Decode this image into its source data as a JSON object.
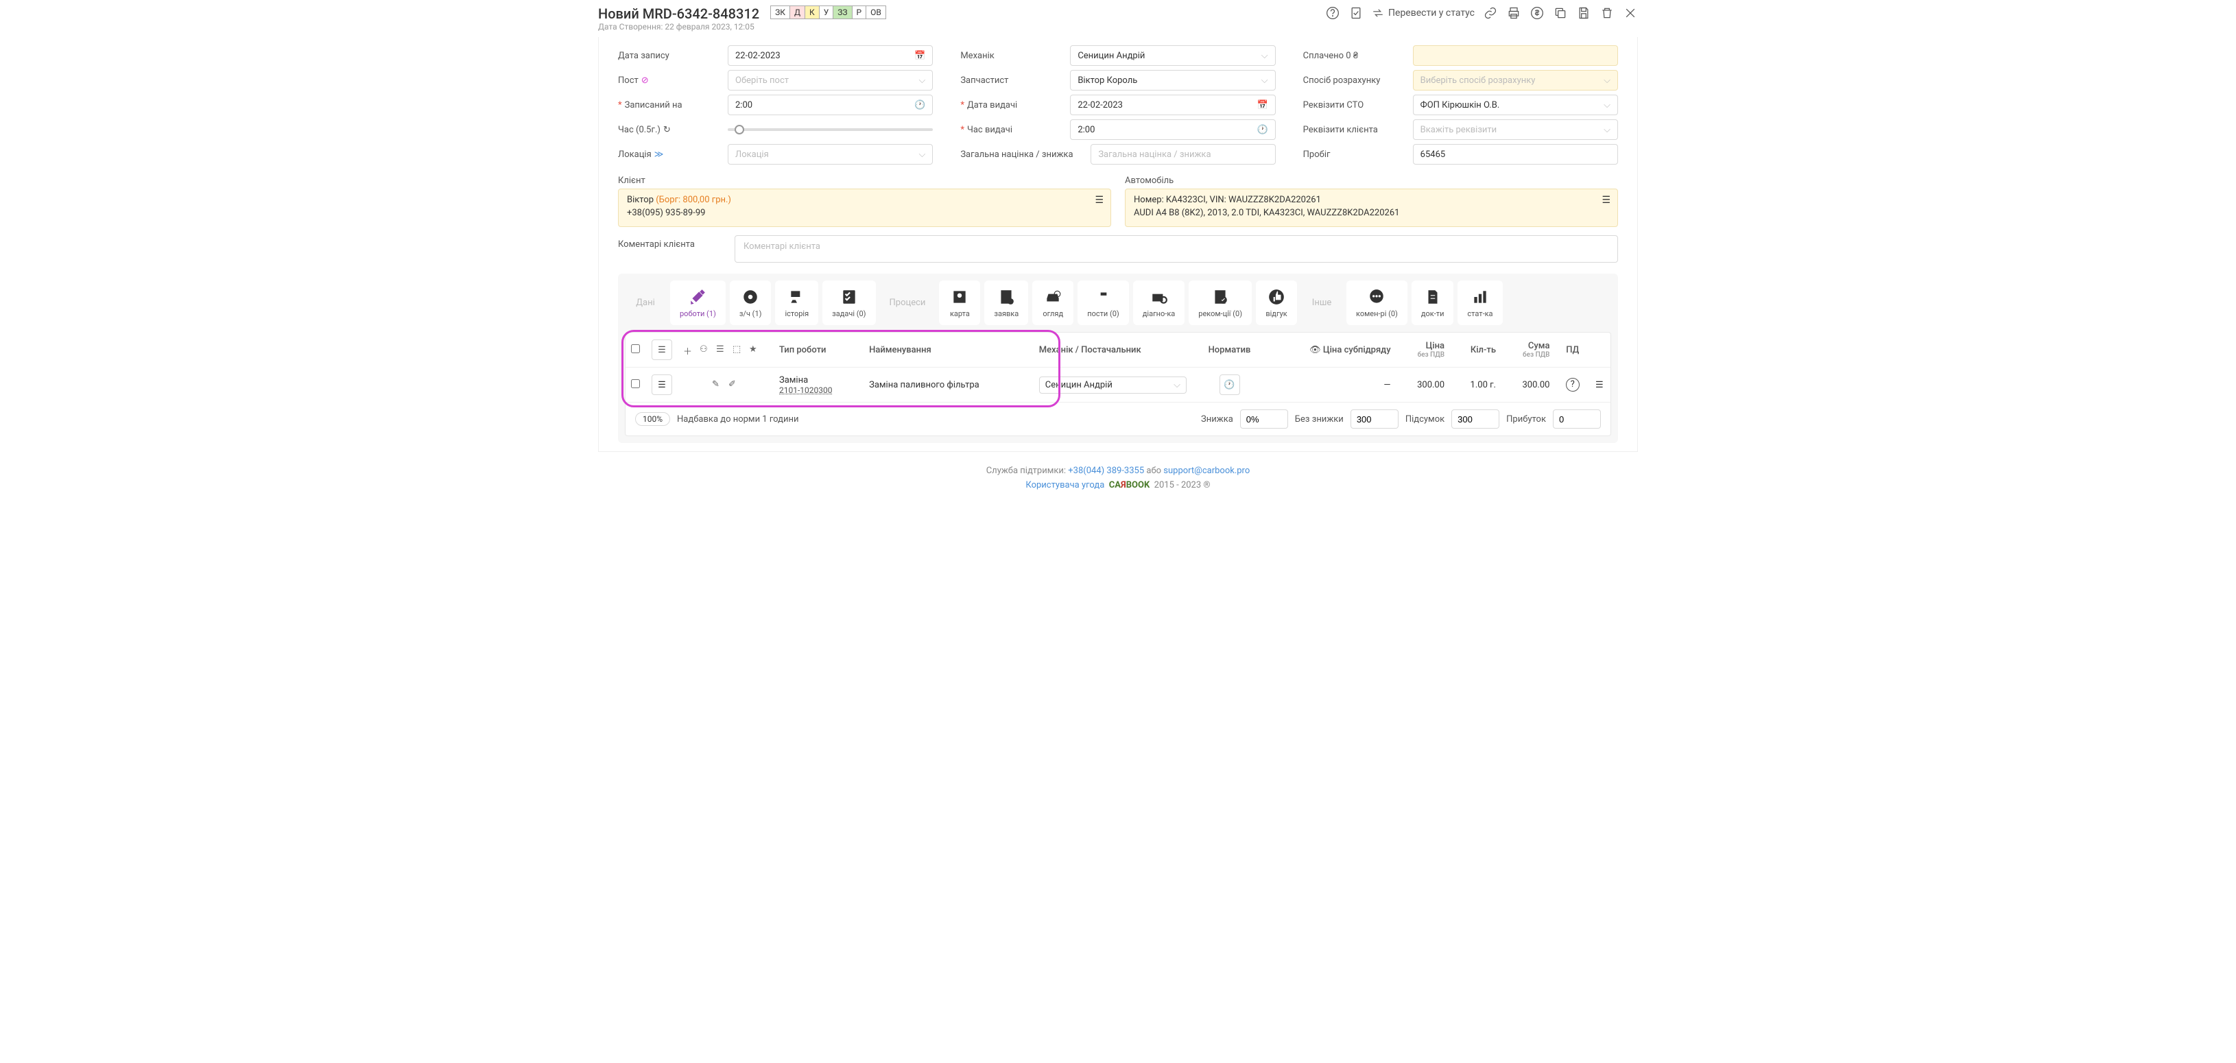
{
  "header": {
    "title": "Новий MRD-6342-848312",
    "subtitle": "Дата Створення: 22 февраля 2023, 12:05",
    "statuses": [
      "ЗК",
      "Д",
      "К",
      "У",
      "ЗЗ",
      "Р",
      "ОВ"
    ],
    "transfer": "Перевести у статус"
  },
  "form": {
    "r1c1_label": "Дата запису",
    "r1c1_value": "22-02-2023",
    "r1c2_label": "Механік",
    "r1c2_value": "Сеницин Андрій",
    "r1c3_label": "Сплачено  0 ₴",
    "r2c1_label": "Пост",
    "r2c1_placeholder": "Оберіть пост",
    "r2c2_label": "Запчастист",
    "r2c2_value": "Віктор Король",
    "r2c3_label": "Спосіб розрахунку",
    "r2c3_placeholder": "Виберіть спосіб розрахунку",
    "r3c1_label": "Записаний на",
    "r3c1_value": "2:00",
    "r3c2_label": "Дата видачі",
    "r3c2_value": "22-02-2023",
    "r3c3_label": "Реквізити СТО",
    "r3c3_value": "ФОП Кірюшкін О.В.",
    "r4c1_label": "Час (0.5г.)",
    "r4c2_label": "Час видачі",
    "r4c2_value": "2:00",
    "r4c3_label": "Реквізити клієнта",
    "r4c3_placeholder": "Вкажіть реквізити",
    "r5c1_label": "Локація",
    "r5c1_placeholder": "Локація",
    "r5c2_label": "Загальна націнка / знижка",
    "r5c2_placeholder": "Загальна націнка / знижка",
    "r5c3_label": "Пробіг",
    "r5c3_value": "65465"
  },
  "client": {
    "label": "Клієнт",
    "name": "Віктор",
    "debt": "(Борг: 800,00 грн.)",
    "phone": "+38(095) 935-89-99"
  },
  "vehicle": {
    "label": "Автомобіль",
    "line1": "Номер: KA4323CI,  VIN: WAUZZZ8K2DA220261",
    "line2": "AUDI A4 B8 (8K2), 2013, 2.0 TDI, KA4323CI, WAUZZZ8K2DA220261"
  },
  "comment": {
    "label": "Коментарі клієнта",
    "placeholder": "Коментарі клієнта"
  },
  "tabs": {
    "dani": "Дані",
    "works": "роботи (1)",
    "parts": "з/ч (1)",
    "history": "історія",
    "tasks": "задачі (0)",
    "processes": "Процеси",
    "map": "карта",
    "request": "заявка",
    "review": "огляд",
    "posts": "пости (0)",
    "diag": "діагно-ка",
    "recom": "реком-ції (0)",
    "feedback": "відгук",
    "other": "Інше",
    "comments": "комен-рі (0)",
    "docs": "док-ти",
    "stats": "стат-ка"
  },
  "table": {
    "h_type": "Тип роботи",
    "h_name": "Найменування",
    "h_mechanic": "Механік / Постачальник",
    "h_norm": "Норматив",
    "h_subprice": "Ціна субпідряду",
    "h_price": "Ціна",
    "h_price_sub": "без ПДВ",
    "h_qty": "Кіл-ть",
    "h_sum": "Сума",
    "h_sum_sub": "без ПДВ",
    "h_pd": "ПД",
    "row": {
      "type": "Заміна",
      "code": "2101-1020300",
      "name": "Заміна паливного фільтра",
      "mechanic": "Сеницин Андрій",
      "subprice": "—",
      "price": "300.00",
      "qty": "1.00 г.",
      "sum": "300.00"
    }
  },
  "footer": {
    "badge": "100%",
    "surcharge": "Надбавка до норми 1 години",
    "discount_l": "Знижка",
    "discount_v": "0%",
    "nodisc_l": "Без знижки",
    "nodisc_v": "300",
    "subtotal_l": "Підсумок",
    "subtotal_v": "300",
    "profit_l": "Прибуток",
    "profit_v": "0"
  },
  "copyright": {
    "support": "Служба підтримки:",
    "phone": "+38(044) 389-3355",
    "or": "або",
    "email": "support@carbook.pro",
    "agreement": "Користувача угода",
    "years": "2015 - 2023 ®"
  }
}
